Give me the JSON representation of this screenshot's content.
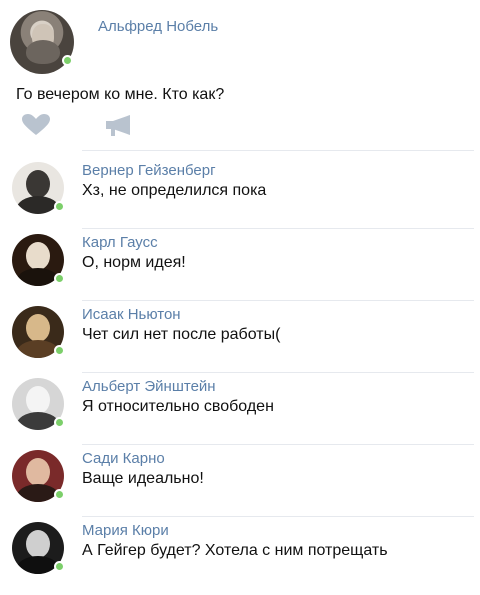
{
  "post": {
    "author": "Альфред Нобель",
    "text": "Го вечером ко мне. Кто как?",
    "icons": {
      "like": "heart-icon",
      "share": "megaphone-icon"
    }
  },
  "comments": [
    {
      "name": "Вернер Гейзенберг",
      "text": "Хз, не определился пока"
    },
    {
      "name": "Карл Гаусс",
      "text": "О, норм идея!"
    },
    {
      "name": "Исаак Ньютон",
      "text": "Чет сил нет после работы("
    },
    {
      "name": "Альберт Эйнштейн",
      "text": "Я относительно свободен"
    },
    {
      "name": "Сади Карно",
      "text": "Ваще идеально!"
    },
    {
      "name": "Мария Кюри",
      "text": "А Гейгер будет? Хотела с ним потрещать"
    }
  ],
  "colors": {
    "name_link": "#5b7fa8",
    "online": "#7ccf6a",
    "divider": "#e6e9ee",
    "icon": "#b9c3cf"
  }
}
